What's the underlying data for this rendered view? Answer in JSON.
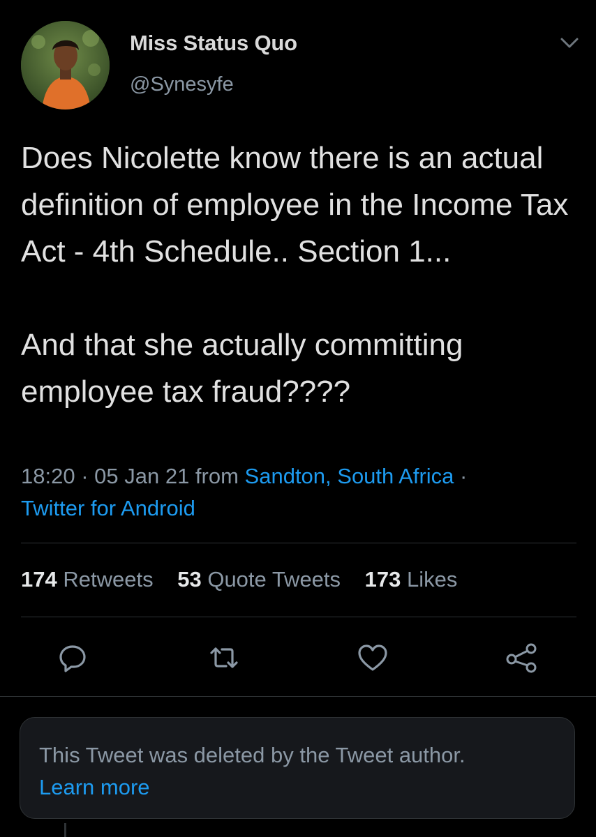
{
  "author": {
    "display_name": "Miss Status Quo",
    "handle": "@Synesyfe",
    "avatar_icon": "user-avatar-photo"
  },
  "tweet": {
    "paragraphs": [
      "Does Nicolette know there is an actual definition of employee in the Income Tax Act - 4th Schedule.. Section 1...",
      "And that she actually committing employee tax fraud????"
    ],
    "time": "18:20",
    "separator": " · ",
    "date": "05 Jan 21",
    "from_label": " from ",
    "location": "Sandton, South Africa",
    "trailing_separator": " ·",
    "source": "Twitter for Android"
  },
  "stats": {
    "retweets_count": "174",
    "retweets_label": "Retweets",
    "quotes_count": "53",
    "quotes_label": "Quote Tweets",
    "likes_count": "173",
    "likes_label": "Likes"
  },
  "actions": {
    "reply_icon": "reply-icon",
    "retweet_icon": "retweet-icon",
    "like_icon": "heart-icon",
    "share_icon": "share-icon"
  },
  "deleted_notice": {
    "text": "This Tweet was deleted by the Tweet author.",
    "link": "Learn more"
  },
  "colors": {
    "background": "#000000",
    "text": "#e1e1e1",
    "secondary": "#8b98a5",
    "link": "#1d9bf0",
    "border": "#2f3336"
  }
}
